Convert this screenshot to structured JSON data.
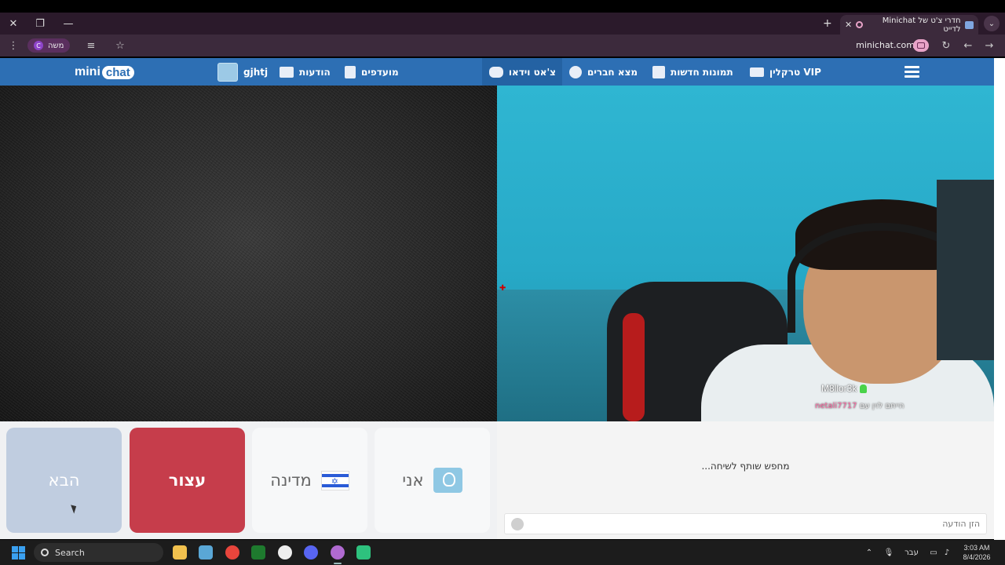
{
  "browser": {
    "tab_title": "חדרי צ'ט של Minichat לדייט",
    "url": "minichat.com",
    "profile_name": "משה",
    "profile_initial": "C"
  },
  "header": {
    "logo_mini": "mini",
    "logo_chat": "chat",
    "nav": {
      "vip": "VIP טרקלין",
      "new_photos": "תמונות חדשות",
      "find_friends": "מצא חברים",
      "video_chat": "צ'אט וידאו",
      "favorites": "מועדפים",
      "messages": "הודעות",
      "username": "gjhtj"
    }
  },
  "video": {
    "peer_name": "M8llor3k",
    "peer_subtitle_pink": "netali7717",
    "peer_subtitle_text": "הייתם לוין עם"
  },
  "controls": {
    "next_label": "הבא",
    "stop_label": "עצור",
    "country_label": "מדינה",
    "me_label": "אני"
  },
  "chat": {
    "status": "מחפש שותף לשיחה...",
    "input_placeholder": "הזן הודעה"
  },
  "taskbar": {
    "search_label": "Search",
    "language": "עבר",
    "time": "3:03 AM",
    "date": "8/4/2026"
  },
  "colors": {
    "header_blue": "#2d6fb4",
    "stop_red": "#c63d4b",
    "next_gray_blue": "#c0cde0",
    "peer_bg_cyan": "#2fb6d2"
  }
}
